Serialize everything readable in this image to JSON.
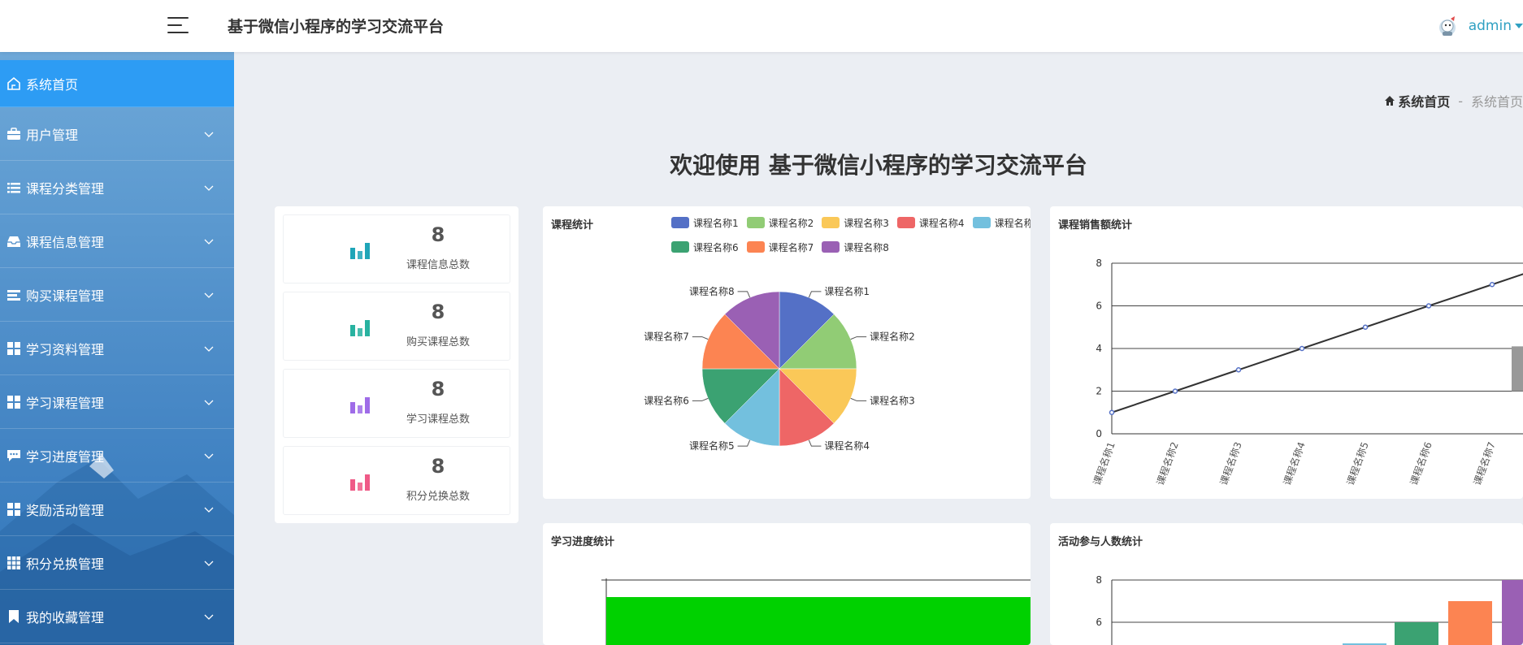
{
  "header": {
    "title": "基于微信小程序的学习交流平台",
    "user": "admin"
  },
  "sidebar": {
    "items": [
      {
        "label": "系统首页",
        "icon": "home-icon"
      },
      {
        "label": "用户管理",
        "icon": "briefcase-icon"
      },
      {
        "label": "课程分类管理",
        "icon": "list-icon"
      },
      {
        "label": "课程信息管理",
        "icon": "inbox-icon"
      },
      {
        "label": "购买课程管理",
        "icon": "list-alt-icon"
      },
      {
        "label": "学习资料管理",
        "icon": "grid-icon"
      },
      {
        "label": "学习课程管理",
        "icon": "grid-icon"
      },
      {
        "label": "学习进度管理",
        "icon": "comment-icon"
      },
      {
        "label": "奖励活动管理",
        "icon": "grid-icon"
      },
      {
        "label": "积分兑换管理",
        "icon": "grid-small-icon"
      },
      {
        "label": "我的收藏管理",
        "icon": "bookmark-icon"
      }
    ]
  },
  "breadcrumb": {
    "home": "系统首页",
    "separator": "-",
    "current": "系统首页"
  },
  "welcome": "欢迎使用 基于微信小程序的学习交流平台",
  "stats": [
    {
      "value": "8",
      "label": "课程信息总数",
      "color": "#1fa5b8"
    },
    {
      "value": "8",
      "label": "购买课程总数",
      "color": "#28b2a0"
    },
    {
      "value": "8",
      "label": "学习课程总数",
      "color": "#9f6ce8"
    },
    {
      "value": "8",
      "label": "积分兑换总数",
      "color": "#ef5a87"
    }
  ],
  "panels": {
    "pie_title": "课程统计",
    "line_title": "课程销售额统计",
    "progress_title": "学习进度统计",
    "activity_title": "活动参与人数统计"
  },
  "colors": {
    "sidebar_active": "#2d9cf4",
    "accent": "#2fa0c2",
    "progress_bar": "#00d100"
  },
  "chart_data": [
    {
      "type": "pie",
      "title": "课程统计",
      "categories": [
        "课程名称1",
        "课程名称2",
        "课程名称3",
        "课程名称4",
        "课程名称5",
        "课程名称6",
        "课程名称7",
        "课程名称8"
      ],
      "values": [
        1,
        1,
        1,
        1,
        1,
        1,
        1,
        1
      ],
      "colors": [
        "#5470c6",
        "#91cc75",
        "#fac858",
        "#ee6666",
        "#73c0de",
        "#3ba272",
        "#fc8452",
        "#9a60b4"
      ],
      "legend": "top"
    },
    {
      "type": "line",
      "title": "课程销售额统计",
      "categories": [
        "课程名称1",
        "课程名称2",
        "课程名称3",
        "课程名称4",
        "课程名称5",
        "课程名称6",
        "课程名称7"
      ],
      "values": [
        1,
        2,
        3,
        4,
        5,
        6,
        7
      ],
      "ylim": [
        0,
        8
      ],
      "yticks": [
        0,
        2,
        4,
        6,
        8
      ],
      "grid": true
    },
    {
      "type": "bar",
      "title": "学习进度统计",
      "values": [
        8
      ],
      "colors": [
        "#00d100"
      ]
    },
    {
      "type": "bar",
      "title": "活动参与人数统计",
      "yticks": [
        6,
        8
      ],
      "values": [
        5,
        6,
        7,
        8
      ],
      "colors": [
        "#73c0de",
        "#3ba272",
        "#fc8452",
        "#9a60b4"
      ],
      "grid": true
    }
  ]
}
